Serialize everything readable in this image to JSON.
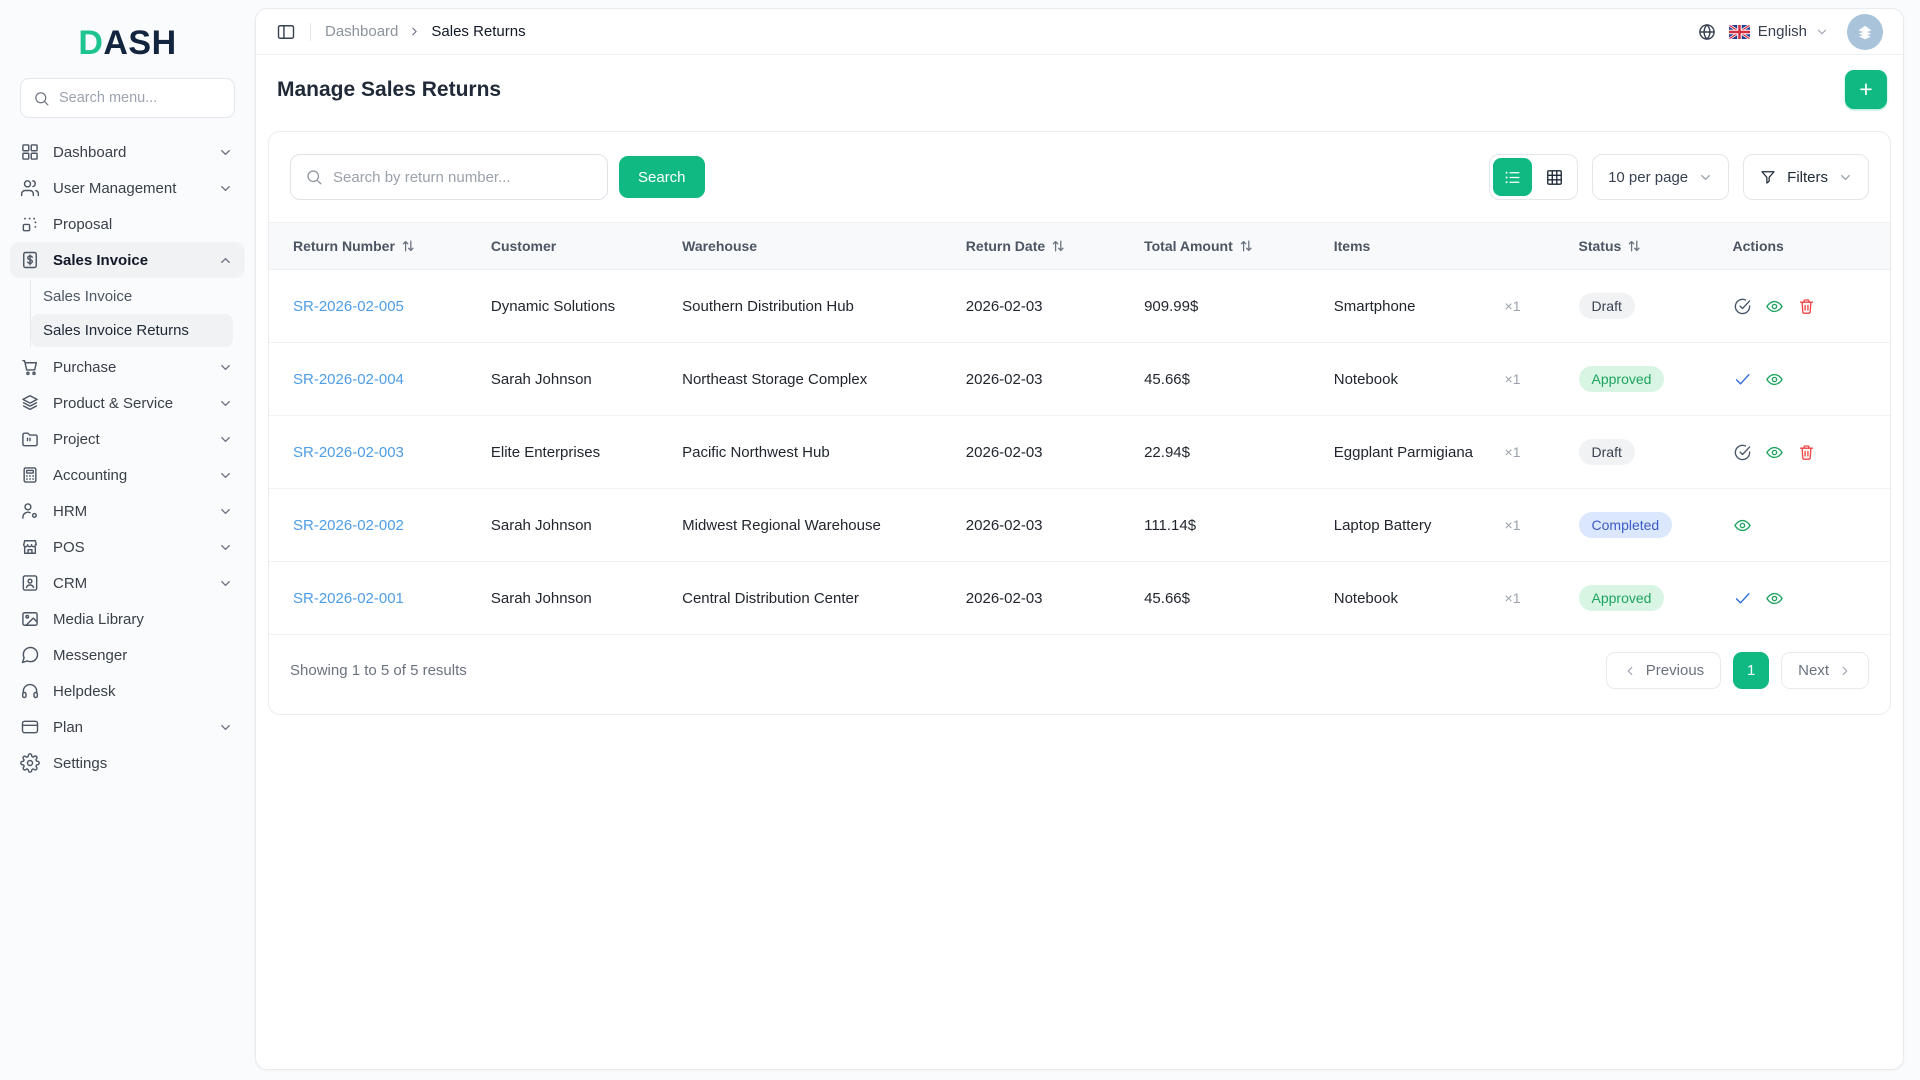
{
  "brand": {
    "logo_prefix": "D",
    "logo_suffix": "ASH"
  },
  "sidebar": {
    "search_placeholder": "Search menu...",
    "items": [
      {
        "label": "Dashboard",
        "icon": "dashboard-icon",
        "expandable": true
      },
      {
        "label": "User Management",
        "icon": "users-icon",
        "expandable": true
      },
      {
        "label": "Proposal",
        "icon": "proposal-icon",
        "expandable": false
      },
      {
        "label": "Sales Invoice",
        "icon": "invoice-icon",
        "expandable": true,
        "expanded": true,
        "active": true
      },
      {
        "label": "Purchase",
        "icon": "cart-icon",
        "expandable": true
      },
      {
        "label": "Product & Service",
        "icon": "layers-icon",
        "expandable": true
      },
      {
        "label": "Project",
        "icon": "folder-icon",
        "expandable": true
      },
      {
        "label": "Accounting",
        "icon": "calculator-icon",
        "expandable": true
      },
      {
        "label": "HRM",
        "icon": "person-icon",
        "expandable": true
      },
      {
        "label": "POS",
        "icon": "store-icon",
        "expandable": true
      },
      {
        "label": "CRM",
        "icon": "id-card-icon",
        "expandable": true
      },
      {
        "label": "Media Library",
        "icon": "image-icon",
        "expandable": false
      },
      {
        "label": "Messenger",
        "icon": "chat-icon",
        "expandable": false
      },
      {
        "label": "Helpdesk",
        "icon": "headset-icon",
        "expandable": false
      },
      {
        "label": "Plan",
        "icon": "credit-card-icon",
        "expandable": true
      },
      {
        "label": "Settings",
        "icon": "gear-icon",
        "expandable": false
      }
    ],
    "sales_invoice_subitems": [
      {
        "label": "Sales Invoice",
        "selected": false
      },
      {
        "label": "Sales Invoice Returns",
        "selected": true
      }
    ]
  },
  "topbar": {
    "breadcrumb_home": "Dashboard",
    "breadcrumb_current": "Sales Returns",
    "language": "English"
  },
  "page": {
    "title": "Manage Sales Returns",
    "add_button_label": "+"
  },
  "toolbar": {
    "search_placeholder": "Search by return number...",
    "search_button_label": "Search",
    "per_page_selected": "10 per page",
    "filters_label": "Filters"
  },
  "table": {
    "headers": [
      {
        "label": "Return Number",
        "sortable": true
      },
      {
        "label": "Customer",
        "sortable": false
      },
      {
        "label": "Warehouse",
        "sortable": false
      },
      {
        "label": "Return Date",
        "sortable": true
      },
      {
        "label": "Total Amount",
        "sortable": true
      },
      {
        "label": "Items",
        "sortable": false
      },
      {
        "label": "Status",
        "sortable": true
      },
      {
        "label": "Actions",
        "sortable": false
      }
    ],
    "rows": [
      {
        "return_number": "SR-2026-02-005",
        "customer": "Dynamic Solutions",
        "warehouse": "Southern Distribution Hub",
        "return_date": "2026-02-03",
        "total_amount": "909.99$",
        "item": "Smartphone",
        "quantity": "×1",
        "status": "Draft",
        "actions": [
          "approve",
          "view",
          "delete"
        ]
      },
      {
        "return_number": "SR-2026-02-004",
        "customer": "Sarah Johnson",
        "warehouse": "Northeast Storage Complex",
        "return_date": "2026-02-03",
        "total_amount": "45.66$",
        "item": "Notebook",
        "quantity": "×1",
        "status": "Approved",
        "actions": [
          "complete",
          "view"
        ]
      },
      {
        "return_number": "SR-2026-02-003",
        "customer": "Elite Enterprises",
        "warehouse": "Pacific Northwest Hub",
        "return_date": "2026-02-03",
        "total_amount": "22.94$",
        "item": "Eggplant Parmigiana",
        "quantity": "×1",
        "status": "Draft",
        "actions": [
          "approve",
          "view",
          "delete"
        ]
      },
      {
        "return_number": "SR-2026-02-002",
        "customer": "Sarah Johnson",
        "warehouse": "Midwest Regional Warehouse",
        "return_date": "2026-02-03",
        "total_amount": "111.14$",
        "item": "Laptop Battery",
        "quantity": "×1",
        "status": "Completed",
        "actions": [
          "view"
        ]
      },
      {
        "return_number": "SR-2026-02-001",
        "customer": "Sarah Johnson",
        "warehouse": "Central Distribution Center",
        "return_date": "2026-02-03",
        "total_amount": "45.66$",
        "item": "Notebook",
        "quantity": "×1",
        "status": "Approved",
        "actions": [
          "complete",
          "view"
        ]
      }
    ]
  },
  "pagination": {
    "summary": "Showing 1 to 5 of 5 results",
    "previous_label": "Previous",
    "current_page": "1",
    "next_label": "Next"
  },
  "colors": {
    "accent_green": "#10b981",
    "logo_green": "#1ec48d",
    "logo_navy": "#13253e",
    "link_blue": "#4e9de6",
    "status_draft_bg": "#f1f2f4",
    "status_draft_text": "#3a4150",
    "status_approved_bg": "#d8f5e3",
    "status_approved_text": "#1da45f",
    "status_completed_bg": "#dbe7fd",
    "status_completed_text": "#3d5cc5",
    "action_slate": "#475569",
    "action_blue": "#2f6bdb",
    "danger_red": "#ef4444",
    "avatar_bg": "#a9c3da"
  }
}
